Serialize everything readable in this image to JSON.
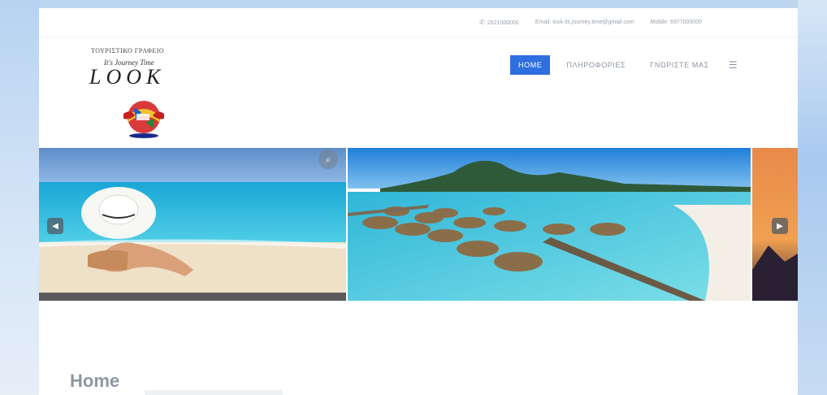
{
  "topbar": {
    "phone": "2621000000",
    "email": "Email: look.its.journey.time@gmail.com",
    "mobile": "Mobile: 6977000000"
  },
  "logo": {
    "tagline": "ΤΟΥΡΙΣΤΙΚΟ ΓΡΑΦΕΙΟ",
    "script": "It's Journey Time",
    "word": "LOOK"
  },
  "nav": {
    "items": [
      {
        "label": "HOME",
        "active": true
      },
      {
        "label": "ΠΛΗΡΟΦΟΡΙΕΣ",
        "active": false
      },
      {
        "label": "ΓΝΩΡΙΣΤΕ ΜΑΣ",
        "active": false
      }
    ]
  },
  "main": {
    "title": "Home"
  },
  "colors": {
    "accent": "#2e6fe0",
    "nav_text": "#8a95a3",
    "sea": "#36c2d4",
    "sky": "#2a8fe0"
  },
  "icons": {
    "phone": "phone-icon",
    "menu": "hamburger-menu-icon",
    "zoom": "search-zoom-icon",
    "prev": "chevron-left-icon",
    "next": "chevron-right-icon"
  }
}
